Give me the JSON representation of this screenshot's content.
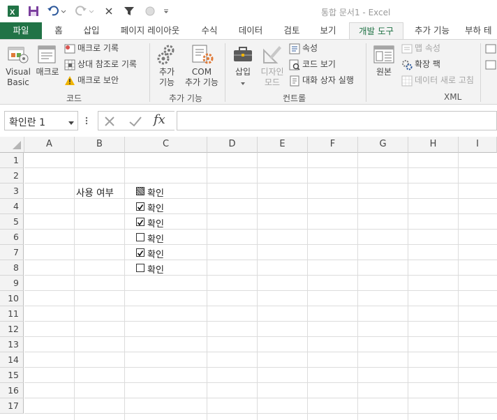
{
  "window": {
    "title": "통합 문서1 - Excel"
  },
  "tabs": [
    {
      "label": "파일"
    },
    {
      "label": "홈"
    },
    {
      "label": "삽입"
    },
    {
      "label": "페이지 레이아웃"
    },
    {
      "label": "수식"
    },
    {
      "label": "데이터"
    },
    {
      "label": "검토"
    },
    {
      "label": "보기"
    },
    {
      "label": "개발 도구"
    },
    {
      "label": "추가 기능"
    },
    {
      "label": "부하 테"
    }
  ],
  "ribbon": {
    "code": {
      "group_label": "코드",
      "visual_basic": "Visual\nBasic",
      "macros": "매크로",
      "record_macro": "매크로 기록",
      "relative_ref": "상대 참조로 기록",
      "macro_security": "매크로 보안"
    },
    "addins": {
      "group_label": "추가 기능",
      "addins_button": "추가\n기능",
      "com_addins": "COM\n추가 기능"
    },
    "controls": {
      "group_label": "컨트롤",
      "insert": "삽입",
      "design_mode": "디자인\n모드",
      "properties": "속성",
      "view_code": "코드 보기",
      "run_dialog": "대화 상자 실행"
    },
    "xml": {
      "group_label": "XML",
      "source": "원본",
      "map_properties": "맵 속성",
      "expansion_packs": "확장 팩",
      "refresh_data": "데이터 새로 고침"
    }
  },
  "formula_bar": {
    "name_box": "확인란 1",
    "fx": "fx",
    "formula": ""
  },
  "columns": [
    "A",
    "B",
    "C",
    "D",
    "E",
    "F",
    "G",
    "H",
    "I"
  ],
  "rows": [
    "1",
    "2",
    "3",
    "4",
    "5",
    "6",
    "7",
    "8",
    "9",
    "10",
    "11",
    "12",
    "13",
    "14",
    "15",
    "16",
    "17"
  ],
  "cells": {
    "B3": "사용 여부"
  },
  "checkboxes": [
    {
      "label": "확인",
      "state": "mixed"
    },
    {
      "label": "확인",
      "state": "checked"
    },
    {
      "label": "확인",
      "state": "checked"
    },
    {
      "label": "확인",
      "state": "unchecked"
    },
    {
      "label": "확인",
      "state": "checked"
    },
    {
      "label": "확인",
      "state": "unchecked"
    }
  ],
  "colors": {
    "excel_green": "#217346"
  }
}
